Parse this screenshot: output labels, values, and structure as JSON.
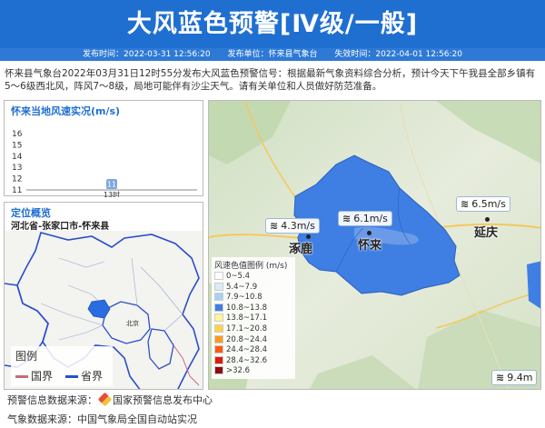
{
  "header": {
    "title": "大风蓝色预警[Ⅳ级/一般]",
    "publish_time": "发布时间：2022-03-31 12:56:20",
    "publisher": "发布单位：怀来县气象台",
    "expire_time": "失效时间：2022-04-01 12:56:20"
  },
  "description": "怀来县气象台2022年03月31日12时55分发布大风蓝色预警信号：根据最新气象资料综合分析，预计今天下午我县全部乡镇有5～6级西北风，阵风7～8级，局地可能伴有沙尘天气。请有关单位和人员做好防范准备。",
  "wind_panel": {
    "title": "怀来当地风速实况(m/s)",
    "yticks": [
      "16",
      "15",
      "14",
      "13",
      "12",
      "11"
    ]
  },
  "chart_data": {
    "type": "bar",
    "categories": [
      "13时"
    ],
    "values": [
      11
    ],
    "title": "怀来当地风速实况(m/s)",
    "ylabel": "",
    "yticks": [
      11,
      12,
      13,
      14,
      15,
      16
    ],
    "ylim": [
      11,
      16
    ],
    "data_labels": [
      "11"
    ],
    "bar_color": "#7da7e0"
  },
  "location_panel": {
    "title": "定位概览",
    "path": "河北省-张家口市-怀来县",
    "legend_title": "图例",
    "legend_items": [
      {
        "label": "国界",
        "color": "#c96a7e"
      },
      {
        "label": "省界",
        "color": "#2b4fc9"
      }
    ],
    "city_label": "北京"
  },
  "map": {
    "cities": [
      {
        "name": "涿鹿"
      },
      {
        "name": "怀来"
      },
      {
        "name": "延庆"
      }
    ],
    "wind_tags": [
      {
        "value": "4.3m/s"
      },
      {
        "value": "6.1m/s"
      },
      {
        "value": "6.5m/s"
      },
      {
        "value": "9.4m"
      }
    ],
    "county_fill": "#3f7fe3",
    "scale_title": "风速色值图例 (m/s)",
    "scale": [
      {
        "label": "0~5.4",
        "color": "#ffffff"
      },
      {
        "label": "5.4~7.9",
        "color": "#d9ecfb"
      },
      {
        "label": "7.9~10.8",
        "color": "#a9d0f5"
      },
      {
        "label": "10.8~13.8",
        "color": "#3f7fe3"
      },
      {
        "label": "13.8~17.1",
        "color": "#fff59a"
      },
      {
        "label": "17.1~20.8",
        "color": "#ffd24a"
      },
      {
        "label": "20.8~24.4",
        "color": "#ff9a1f"
      },
      {
        "label": "24.4~28.4",
        "color": "#ff5a14"
      },
      {
        "label": "28.4~32.6",
        "color": "#e01a0e"
      },
      {
        "label": ">32.6",
        "color": "#8e0a10"
      }
    ]
  },
  "footer": {
    "warning_source": "预警信息数据来源：",
    "warning_source_org": "国家预警信息发布中心",
    "weather_source": "气象数据来源：中国气象局全国自动站实况"
  }
}
